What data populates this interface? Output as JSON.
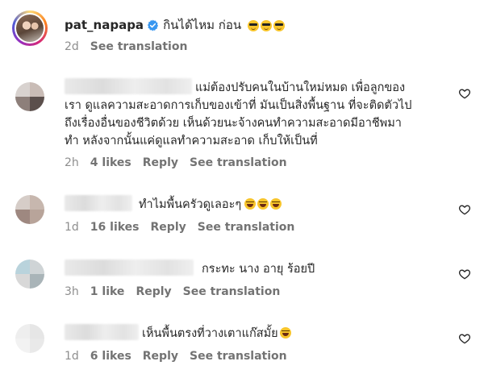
{
  "caption": {
    "username": "pat_napapa",
    "text": "กินได้ไหม ก่อน",
    "emojis": [
      "cool",
      "cool",
      "cool"
    ],
    "time": "2d",
    "see_translation": "See translation"
  },
  "comments": [
    {
      "avatar_colors": [
        "#d8d2cf",
        "#c9bcb6",
        "#8d7f7a",
        "#5b4f4c"
      ],
      "lines": [
        "แม่ต้องปรับคนในบ้านใหม่หมด เพื่อลูกของ",
        "เรา ดูแลความสะอาดการเก็บของเข้าที่ มันเป็นสิ่งพื้นฐาน ที่จะติดตัวไป",
        "ถึงเรื่องอื่นของชีวิตด้วย เห็นด้วยนะจ้างคนทำความสะอาดมีอาชีพมา",
        "ทำ หลังจากนั้นแค่ดูแลทำความสะอาด เก็บให้เป็นที่"
      ],
      "emojis": [],
      "time": "2h",
      "likes": "4 likes",
      "reply": "Reply",
      "see_translation": "See translation"
    },
    {
      "avatar_colors": [
        "#d6cdc8",
        "#c7b7ae",
        "#9e8880",
        "#b8a49a"
      ],
      "lines": [
        "ทำไมพื้นครัวดูเลอะๆ"
      ],
      "emojis": [
        "laugh",
        "laugh",
        "laugh"
      ],
      "time": "1d",
      "likes": "16 likes",
      "reply": "Reply",
      "see_translation": "See translation"
    },
    {
      "avatar_colors": [
        "#b9d3dc",
        "#cfd4d6",
        "#d8d8d8",
        "#a9b4b8"
      ],
      "lines": [
        "กระทะ นาง อายุ ร้อยปี"
      ],
      "emojis": [],
      "time": "3h",
      "likes": "1 like",
      "reply": "Reply",
      "see_translation": "See translation"
    },
    {
      "avatar_colors": [
        "#eeeeee",
        "#e6e6e6",
        "#f2f2f2",
        "#e9e9e9"
      ],
      "lines": [
        "เห็นพื้นตรงที่วางเตาแก๊สมั้ย"
      ],
      "emojis": [
        "laugh"
      ],
      "time": "1d",
      "likes": "6 likes",
      "reply": "Reply",
      "see_translation": "See translation"
    }
  ],
  "colors": {
    "verified": "#3897f0",
    "meta": "#8e8e8e",
    "text": "#262626"
  }
}
